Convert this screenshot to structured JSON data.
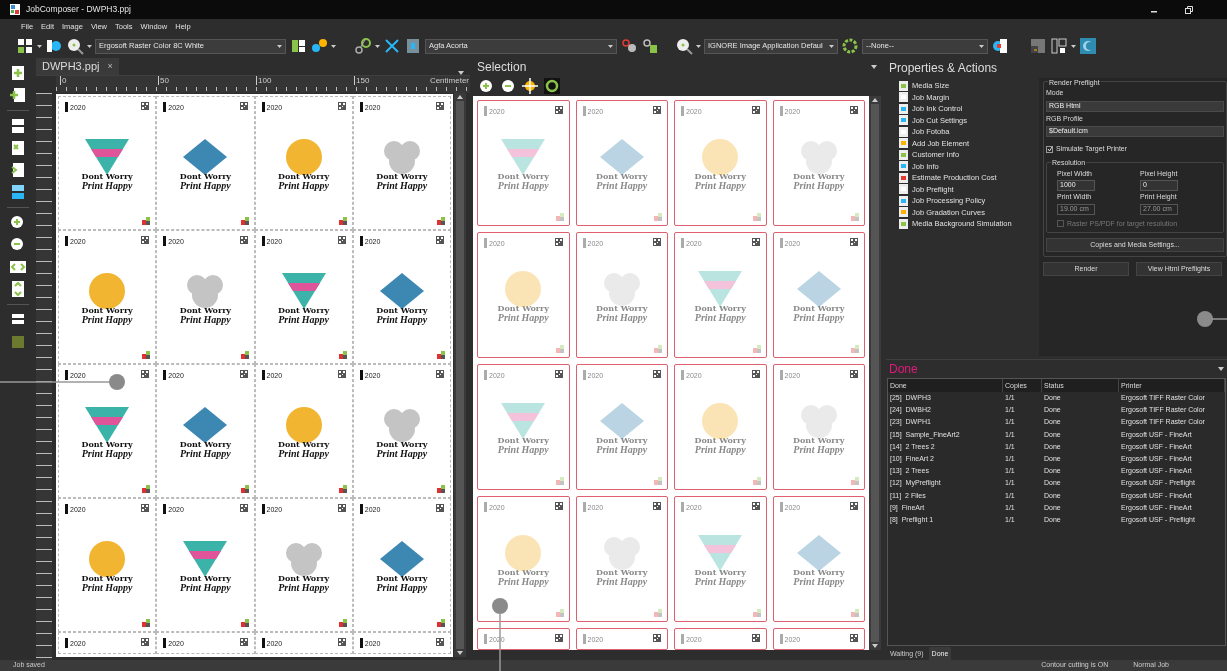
{
  "window": {
    "title": "JobComposer - DWPH3.ppj"
  },
  "menu": [
    "File",
    "Edit",
    "Image",
    "View",
    "Tools",
    "Window",
    "Help"
  ],
  "toolbar": {
    "printer": "Ergosoft Raster Color 8C White",
    "cutter": "Agfa Acorta",
    "image_application": "IGNORE Image Application Defaul",
    "preset": "--None--"
  },
  "document": {
    "tab": "DWPH3.ppj",
    "close": "×",
    "ruler": {
      "ticks": [
        "0",
        "50",
        "100",
        "150"
      ],
      "unit": "Centimeter"
    },
    "cards": [
      {
        "kind": "triangle",
        "year": "2020",
        "lines": [
          "Dont Worry",
          "Print Happy"
        ]
      },
      {
        "kind": "diamond",
        "year": "2020",
        "lines": [
          "Dont Worry",
          "Print Happy"
        ]
      },
      {
        "kind": "circle",
        "year": "2020",
        "lines": [
          "Dont Worry",
          "Print Happy"
        ]
      },
      {
        "kind": "cloud",
        "year": "2020",
        "lines": [
          "Dont Worry",
          "Print Happy"
        ]
      },
      {
        "kind": "circle",
        "year": "2020",
        "lines": [
          "Dont Worry",
          "Print Happy"
        ]
      },
      {
        "kind": "cloud",
        "year": "2020",
        "lines": [
          "Dont Worry",
          "Print Happy"
        ]
      },
      {
        "kind": "triangle",
        "year": "2020",
        "lines": [
          "Dont Worry",
          "Print Happy"
        ]
      },
      {
        "kind": "diamond",
        "year": "2020",
        "lines": [
          "Dont Worry",
          "Print Happy"
        ]
      },
      {
        "kind": "triangle",
        "year": "2020",
        "lines": [
          "Dont Worry",
          "Print Happy"
        ]
      },
      {
        "kind": "diamond",
        "year": "2020",
        "lines": [
          "Dont Worry",
          "Print Happy"
        ]
      },
      {
        "kind": "circle",
        "year": "2020",
        "lines": [
          "Dont Worry",
          "Print Happy"
        ]
      },
      {
        "kind": "cloud",
        "year": "2020",
        "lines": [
          "Dont Worry",
          "Print Happy"
        ]
      },
      {
        "kind": "circle",
        "year": "2020",
        "lines": [
          "Dont Worry",
          "Print Happy"
        ]
      },
      {
        "kind": "triangle",
        "year": "2020",
        "lines": [
          "Dont Worry",
          "Print Happy"
        ]
      },
      {
        "kind": "cloud",
        "year": "2020",
        "lines": [
          "Dont Worry",
          "Print Happy"
        ]
      },
      {
        "kind": "diamond",
        "year": "2020",
        "lines": [
          "Dont Worry",
          "Print Happy"
        ]
      },
      {
        "kind": "partial",
        "year": "2020"
      },
      {
        "kind": "partial",
        "year": "2020"
      },
      {
        "kind": "partial",
        "year": "2020"
      },
      {
        "kind": "partial",
        "year": "2020"
      }
    ]
  },
  "selection": {
    "title": "Selection",
    "cards": [
      {
        "kind": "triangle",
        "year": "2020",
        "lines": [
          "Dont Worry",
          "Print Happy"
        ]
      },
      {
        "kind": "diamond",
        "year": "2020",
        "lines": [
          "Dont Worry",
          "Print Happy"
        ]
      },
      {
        "kind": "circle",
        "year": "2020",
        "lines": [
          "Dont Worry",
          "Print Happy"
        ]
      },
      {
        "kind": "cloud",
        "year": "2020",
        "lines": [
          "Dont Worry",
          "Print Happy"
        ]
      },
      {
        "kind": "circle",
        "year": "2020",
        "lines": [
          "Dont Worry",
          "Print Happy"
        ]
      },
      {
        "kind": "cloud",
        "year": "2020",
        "lines": [
          "Dont Worry",
          "Print Happy"
        ]
      },
      {
        "kind": "triangle",
        "year": "2020",
        "lines": [
          "Dont Worry",
          "Print Happy"
        ]
      },
      {
        "kind": "diamond",
        "year": "2020",
        "lines": [
          "Dont Worry",
          "Print Happy"
        ]
      },
      {
        "kind": "triangle",
        "year": "2020",
        "lines": [
          "Dont Worry",
          "Print Happy"
        ]
      },
      {
        "kind": "diamond",
        "year": "2020",
        "lines": [
          "Dont Worry",
          "Print Happy"
        ]
      },
      {
        "kind": "circle",
        "year": "2020",
        "lines": [
          "Dont Worry",
          "Print Happy"
        ]
      },
      {
        "kind": "cloud",
        "year": "2020",
        "lines": [
          "Dont Worry",
          "Print Happy"
        ]
      },
      {
        "kind": "circle",
        "year": "2020",
        "lines": [
          "Dont Worry",
          "Print Happy"
        ]
      },
      {
        "kind": "cloud",
        "year": "2020",
        "lines": [
          "Dont Worry",
          "Print Happy"
        ]
      },
      {
        "kind": "triangle",
        "year": "2020",
        "lines": [
          "Dont Worry",
          "Print Happy"
        ]
      },
      {
        "kind": "diamond",
        "year": "2020",
        "lines": [
          "Dont Worry",
          "Print Happy"
        ]
      },
      {
        "kind": "partial",
        "year": "2020"
      },
      {
        "kind": "partial",
        "year": "2020"
      },
      {
        "kind": "partial",
        "year": "2020"
      },
      {
        "kind": "partial",
        "year": "2020"
      }
    ]
  },
  "properties": {
    "title": "Properties & Actions",
    "actions": [
      "Media Size",
      "Job Margin",
      "Job Ink Control",
      "Job Cut Settings",
      "Job Fotoba",
      "Add Job Element",
      "Customer Info",
      "Job Info",
      "Estimate Production Cost",
      "Job Preflight",
      "Job Processing Policy",
      "Job Gradation Curves",
      "Media Background Simulation"
    ],
    "render_preflight": {
      "legend": "Render Preflight",
      "mode_label": "Mode",
      "mode": "RGB Html",
      "profile_label": "RGB Profile",
      "profile": "$Default.icm",
      "simulate": {
        "label": "Simulate Target Printer",
        "checked": true,
        "disabled": false
      },
      "resolution": {
        "legend": "Resolution",
        "fields": [
          {
            "label": "Pixel Width",
            "value": "1000",
            "disabled": false
          },
          {
            "label": "Pixel Height",
            "value": "0",
            "disabled": false
          },
          {
            "label": "Print Width",
            "value": "19.00 cm",
            "disabled": true
          },
          {
            "label": "Print Height",
            "value": "27.00 cm",
            "disabled": true
          }
        ],
        "raster": {
          "label": "Raster PS/PDF for target resolution",
          "checked": false,
          "disabled": true
        }
      },
      "copies_button": "Copies and Media Settings...",
      "buttons": [
        "Render",
        "View Html Preflights"
      ]
    }
  },
  "done_panel": {
    "title": "Done",
    "columns": [
      "Done",
      "Copies",
      "Status",
      "Printer"
    ],
    "rows": [
      [
        "[25]  DWPH3",
        "1/1",
        "Done",
        "Ergosoft TIFF Raster Color"
      ],
      [
        "[24]  DWBH2",
        "1/1",
        "Done",
        "Ergosoft TIFF Raster Color"
      ],
      [
        "[23]  DWPH1",
        "1/1",
        "Done",
        "Ergosoft TIFF Raster Color"
      ],
      [
        "[15]  Sample_FineArt2",
        "1/1",
        "Done",
        "Ergosoft USF - FineArt"
      ],
      [
        "[14]  2 Trees 2",
        "1/1",
        "Done",
        "Ergosoft USF - FineArt"
      ],
      [
        "[10]  FineArt 2",
        "1/1",
        "Done",
        "Ergosoft USF - FineArt"
      ],
      [
        "[13]  2 Trees",
        "1/1",
        "Done",
        "Ergosoft USF - FineArt"
      ],
      [
        "[12]  MyPreflight",
        "1/1",
        "Done",
        "Ergosoft USF - Preflight"
      ],
      [
        "[11]  2 Files",
        "1/1",
        "Done",
        "Ergosoft USF - FineArt"
      ],
      [
        "[9]  FineArt",
        "1/1",
        "Done",
        "Ergosoft USF - FineArt"
      ],
      [
        "[8]  Preflight 1",
        "1/1",
        "Done",
        "Ergosoft USF - Preflight"
      ]
    ],
    "tabs": [
      {
        "label": "Waiting (9)",
        "selected": false
      },
      {
        "label": "Done",
        "selected": true
      }
    ]
  },
  "status_bar": {
    "message": "Job saved",
    "cutting": "Contour cutting is ON",
    "job_type": "Normal Job"
  }
}
